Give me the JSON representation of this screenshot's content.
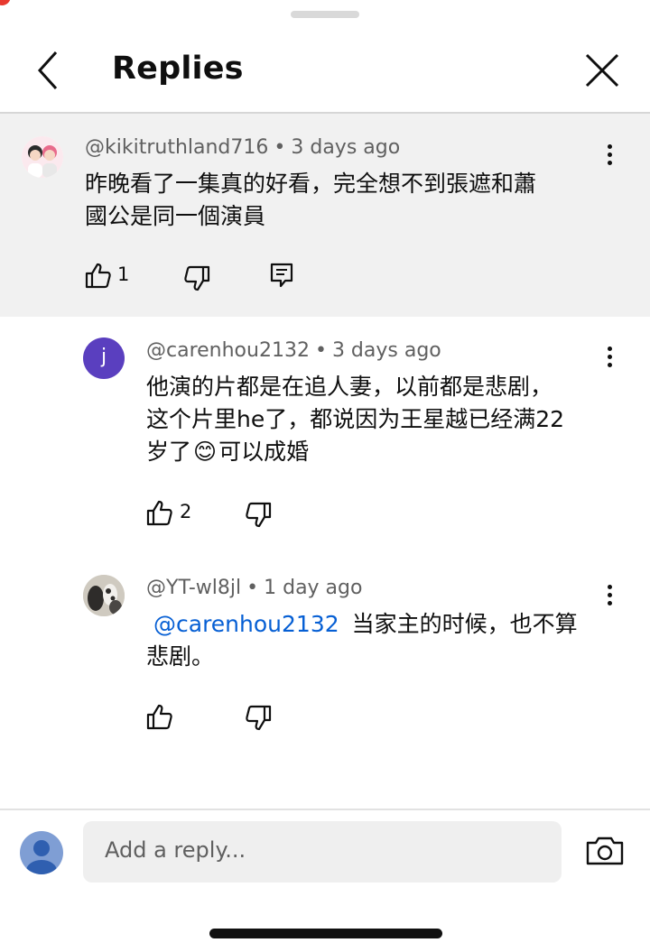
{
  "header": {
    "title": "Replies"
  },
  "comments": [
    {
      "author": "@kikitruthland716",
      "time": "3 days ago",
      "lines": [
        "昨晚看了一集真的好看，完全想不到張遮和蕭",
        "國公是同一個演員"
      ],
      "likes": "1"
    },
    {
      "author": "@carenhou2132",
      "time": "3 days ago",
      "avatar_letter": "j",
      "lines": [
        "他演的片都是在追人妻，以前都是悲剧，",
        "这个片里he了，都说因为王星越已经满22",
        "岁了",
        "可以成婚"
      ],
      "emoji": "😊",
      "likes": "2"
    },
    {
      "author": "@YT-wl8jl",
      "time": "1 day ago",
      "mention": "@carenhou2132",
      "lines": [
        "当家主的时候，也不算",
        "悲剧。"
      ]
    }
  ],
  "composer": {
    "placeholder": "Add a reply..."
  },
  "separator": "•",
  "colors": {
    "mention": "#065fd4",
    "parent_bg": "#f1f1f1",
    "avatar_purple": "#5a3fbf"
  },
  "icons": [
    "chevron-left-icon",
    "close-icon",
    "more-vert-icon",
    "thumb-up-icon",
    "thumb-down-icon",
    "reply-icon",
    "camera-icon",
    "account-icon"
  ]
}
